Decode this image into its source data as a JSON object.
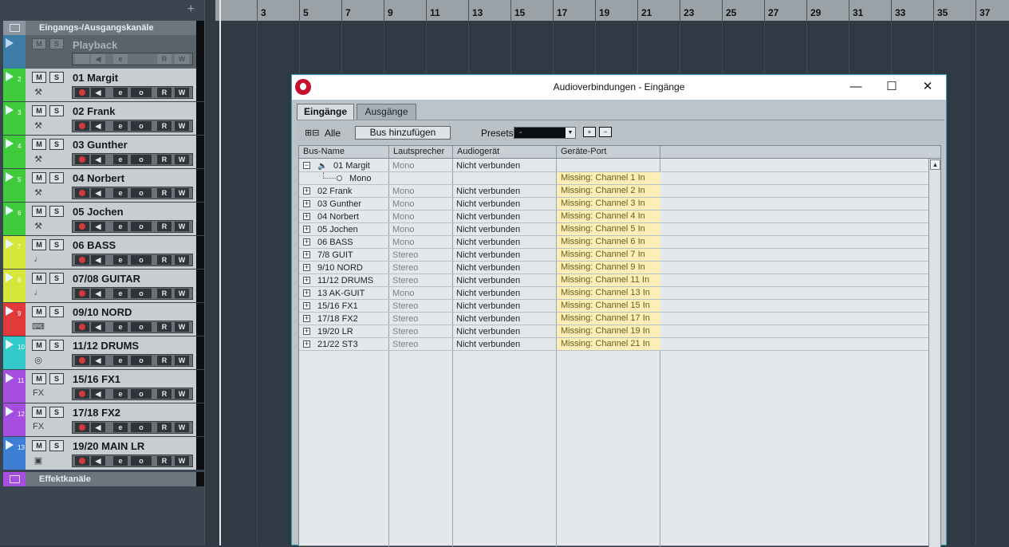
{
  "tracklist": {
    "add_button": "+",
    "input_output_folder": "Eingangs-/Ausgangskanäle",
    "effects_folder": "Effektkanäle",
    "playback": {
      "name": "Playback",
      "m": "M",
      "s": "S",
      "e": "e",
      "r": "R",
      "w": "W"
    },
    "tracks": [
      {
        "num": "2",
        "name": "01 Margit",
        "color": "#3fcb3b",
        "icon": "mic-icon",
        "glyph": "⚒"
      },
      {
        "num": "3",
        "name": "02 Frank",
        "color": "#3fcb3b",
        "icon": "mic-icon",
        "glyph": "⚒"
      },
      {
        "num": "4",
        "name": "03 Gunther",
        "color": "#3fcb3b",
        "icon": "mic-icon",
        "glyph": "⚒"
      },
      {
        "num": "5",
        "name": "04 Norbert",
        "color": "#3fcb3b",
        "icon": "mic-icon",
        "glyph": "⚒"
      },
      {
        "num": "6",
        "name": "05 Jochen",
        "color": "#3fcb3b",
        "icon": "mic-icon",
        "glyph": "⚒"
      },
      {
        "num": "7",
        "name": "06 BASS",
        "color": "#d7e63a",
        "icon": "bass-icon",
        "glyph": "♩"
      },
      {
        "num": "8",
        "name": "07/08 GUITAR",
        "color": "#d7e63a",
        "icon": "guitar-icon",
        "glyph": "♩"
      },
      {
        "num": "9",
        "name": "09/10 NORD",
        "color": "#e23a3a",
        "icon": "keyboard-icon",
        "glyph": "⌨"
      },
      {
        "num": "10",
        "name": "11/12 DRUMS",
        "color": "#33c9c9",
        "icon": "drums-icon",
        "glyph": "◎"
      },
      {
        "num": "11",
        "name": "15/16 FX1",
        "color": "#a54ee0",
        "icon": "fx-icon",
        "glyph": "FX"
      },
      {
        "num": "12",
        "name": "17/18 FX2",
        "color": "#a54ee0",
        "icon": "fx-icon",
        "glyph": "FX"
      },
      {
        "num": "13",
        "name": "19/20 MAIN LR",
        "color": "#3e7fd6",
        "icon": "speaker-icon",
        "glyph": "▣"
      }
    ],
    "labels": {
      "m": "M",
      "s": "S",
      "e": "e",
      "o": "o",
      "r": "R",
      "w": "W"
    }
  },
  "ruler": {
    "bars": [
      "3",
      "5",
      "7",
      "9",
      "11",
      "13",
      "15",
      "17",
      "19",
      "21",
      "23",
      "25",
      "27",
      "29",
      "31",
      "33",
      "35",
      "37"
    ]
  },
  "dialog": {
    "title": "Audioverbindungen - Eingänge",
    "min": "—",
    "max": "☐",
    "close": "✕",
    "tabs": [
      "Eingänge",
      "Ausgänge"
    ],
    "expand_all": "⊞⊟",
    "all_label": "Alle",
    "add_bus": "Bus hinzufügen",
    "presets_label": "Presets",
    "presets_value": "-",
    "columns": [
      "Bus-Name",
      "Lautsprecher",
      "Audiogerät",
      "Geräte-Port"
    ],
    "rows": [
      {
        "expander": "−",
        "name": "01 Margit",
        "speaker": "Mono",
        "device": "Nicht verbunden",
        "port": "",
        "speaker_icon": true
      },
      {
        "sub": true,
        "name": "Mono",
        "speaker": "",
        "device": "",
        "port": "Missing: Channel 1 In"
      },
      {
        "expander": "+",
        "name": "02 Frank",
        "speaker": "Mono",
        "device": "Nicht verbunden",
        "port": "Missing: Channel 2 In"
      },
      {
        "expander": "+",
        "name": "03 Gunther",
        "speaker": "Mono",
        "device": "Nicht verbunden",
        "port": "Missing: Channel 3 In"
      },
      {
        "expander": "+",
        "name": "04 Norbert",
        "speaker": "Mono",
        "device": "Nicht verbunden",
        "port": "Missing: Channel 4 In"
      },
      {
        "expander": "+",
        "name": "05 Jochen",
        "speaker": "Mono",
        "device": "Nicht verbunden",
        "port": "Missing: Channel 5 In"
      },
      {
        "expander": "+",
        "name": "06 BASS",
        "speaker": "Mono",
        "device": "Nicht verbunden",
        "port": "Missing: Channel 6 In"
      },
      {
        "expander": "+",
        "name": "7/8 GUIT",
        "speaker": "Stereo",
        "device": "Nicht verbunden",
        "port": "Missing: Channel 7 In"
      },
      {
        "expander": "+",
        "name": "9/10 NORD",
        "speaker": "Stereo",
        "device": "Nicht verbunden",
        "port": "Missing: Channel 9 In"
      },
      {
        "expander": "+",
        "name": "11/12 DRUMS",
        "speaker": "Stereo",
        "device": "Nicht verbunden",
        "port": "Missing: Channel 11 In"
      },
      {
        "expander": "+",
        "name": "13 AK-GUIT",
        "speaker": "Mono",
        "device": "Nicht verbunden",
        "port": "Missing: Channel 13 In"
      },
      {
        "expander": "+",
        "name": "15/16 FX1",
        "speaker": "Stereo",
        "device": "Nicht verbunden",
        "port": "Missing: Channel 15 In"
      },
      {
        "expander": "+",
        "name": "17/18 FX2",
        "speaker": "Stereo",
        "device": "Nicht verbunden",
        "port": "Missing: Channel 17 In"
      },
      {
        "expander": "+",
        "name": "19/20 LR",
        "speaker": "Stereo",
        "device": "Nicht verbunden",
        "port": "Missing: Channel 19 In"
      },
      {
        "expander": "+",
        "name": "21/22 ST3",
        "speaker": "Stereo",
        "device": "Nicht verbunden",
        "port": "Missing: Channel 21 In"
      }
    ]
  }
}
